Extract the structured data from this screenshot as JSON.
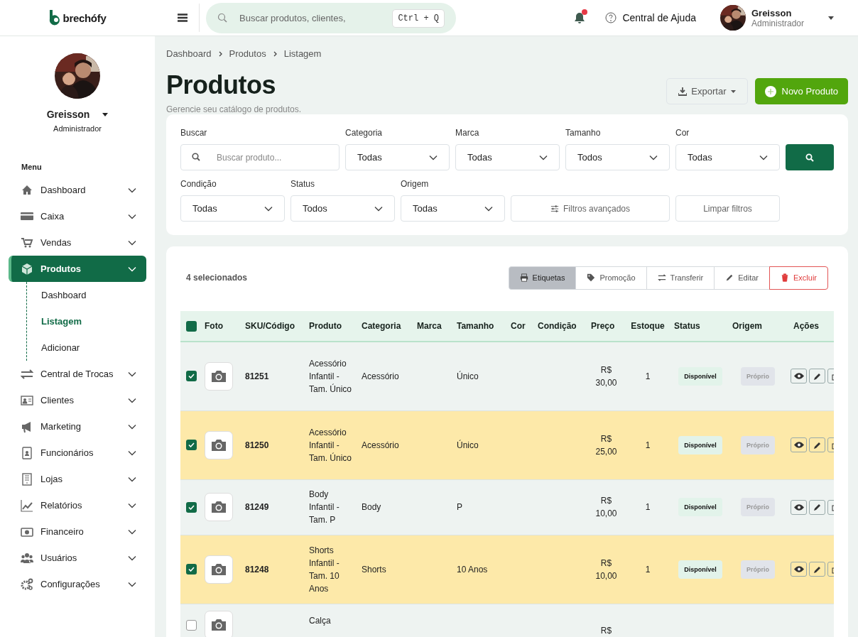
{
  "header": {
    "logo": "brechófy",
    "search": {
      "placeholder": "Buscar produtos, clientes,",
      "shortcut": "Ctrl + Q"
    },
    "notifications": {
      "unread": true
    },
    "help": "Central de Ajuda",
    "user": {
      "name": "Greisson",
      "role": "Administrador"
    }
  },
  "sidebar": {
    "profile": {
      "name": "Greisson",
      "role": "Administrador"
    },
    "menu_title": "Menu",
    "items": [
      {
        "label": "Dashboard",
        "selected": false
      },
      {
        "label": "Caixa",
        "selected": false
      },
      {
        "label": "Vendas",
        "selected": false
      },
      {
        "label": "Produtos",
        "selected": true,
        "children": [
          {
            "label": "Dashboard",
            "selected": false
          },
          {
            "label": "Listagem",
            "selected": true
          },
          {
            "label": "Adicionar",
            "selected": false
          }
        ]
      },
      {
        "label": "Central de Trocas",
        "selected": false
      },
      {
        "label": "Clientes",
        "selected": false
      },
      {
        "label": "Marketing",
        "selected": false
      },
      {
        "label": "Funcionários",
        "selected": false
      },
      {
        "label": "Lojas",
        "selected": false
      },
      {
        "label": "Relatórios",
        "selected": false
      },
      {
        "label": "Financeiro",
        "selected": false
      },
      {
        "label": "Usuários",
        "selected": false
      },
      {
        "label": "Configurações",
        "selected": false
      }
    ]
  },
  "breadcrumb": [
    "Dashboard",
    "Produtos",
    "Listagem"
  ],
  "page": {
    "title": "Produtos",
    "subtitle": "Gerencie seu catálogo de produtos.",
    "export": "Exportar",
    "new": "Novo Produto"
  },
  "filters": {
    "rows": [
      [
        {
          "kind": "search",
          "label": "Buscar",
          "placeholder": "Buscar produto..."
        },
        {
          "kind": "select",
          "label": "Categoria",
          "value": "Todas"
        },
        {
          "kind": "select",
          "label": "Marca",
          "value": "Todas"
        },
        {
          "kind": "select",
          "label": "Tamanho",
          "value": "Todos"
        },
        {
          "kind": "select",
          "label": "Cor",
          "value": "Todas"
        },
        {
          "kind": "icon_button"
        }
      ],
      [
        {
          "kind": "select",
          "label": "Condição",
          "value": "Todas"
        },
        {
          "kind": "select",
          "label": "Status",
          "value": "Todos"
        },
        {
          "kind": "select",
          "label": "Origem",
          "value": "Todas"
        },
        {
          "kind": "advanced_button",
          "text": "Filtros avançados"
        },
        {
          "kind": "clear_button",
          "text": "Limpar filtros"
        }
      ]
    ]
  },
  "bulk": {
    "count": "4 selecionados",
    "actions": [
      {
        "label": "Etiquetas",
        "kind": "active"
      },
      {
        "label": "Promoção",
        "kind": "normal"
      },
      {
        "label": "Transferir",
        "kind": "normal"
      },
      {
        "label": "Editar",
        "kind": "normal"
      },
      {
        "label": "Excluir",
        "kind": "danger"
      }
    ]
  },
  "table": {
    "all_checked": true,
    "columns": [
      "Foto",
      "SKU/Código",
      "Produto",
      "Categoria",
      "Marca",
      "Tamanho",
      "Cor",
      "Condição",
      "Preço",
      "Estoque",
      "Status",
      "Origem",
      "Ações"
    ],
    "rows": [
      {
        "checked": true,
        "sku": "81251",
        "product": "Acessório Infantil - Tam. Único",
        "category": "Acessório",
        "size": "Único",
        "price": "R$ 30,00",
        "stock": "1",
        "status": "Disponível",
        "origin": "Próprio"
      },
      {
        "checked": true,
        "sku": "81250",
        "product": "Acessório Infantil - Tam. Único",
        "category": "Acessório",
        "size": "Único",
        "price": "R$ 25,00",
        "stock": "1",
        "status": "Disponível",
        "origin": "Próprio"
      },
      {
        "checked": true,
        "sku": "81249",
        "product": "Body Infantil - Tam. P",
        "category": "Body",
        "size": "P",
        "price": "R$ 10,00",
        "stock": "1",
        "status": "Disponível",
        "origin": "Próprio"
      },
      {
        "checked": true,
        "sku": "81248",
        "product": "Shorts Infantil - Tam. 10 Anos",
        "category": "Shorts",
        "size": "10 Anos",
        "price": "R$ 10,00",
        "stock": "1",
        "status": "Disponível",
        "origin": "Próprio"
      },
      {
        "checked": false,
        "product": "Calça",
        "price": "R$"
      }
    ]
  }
}
